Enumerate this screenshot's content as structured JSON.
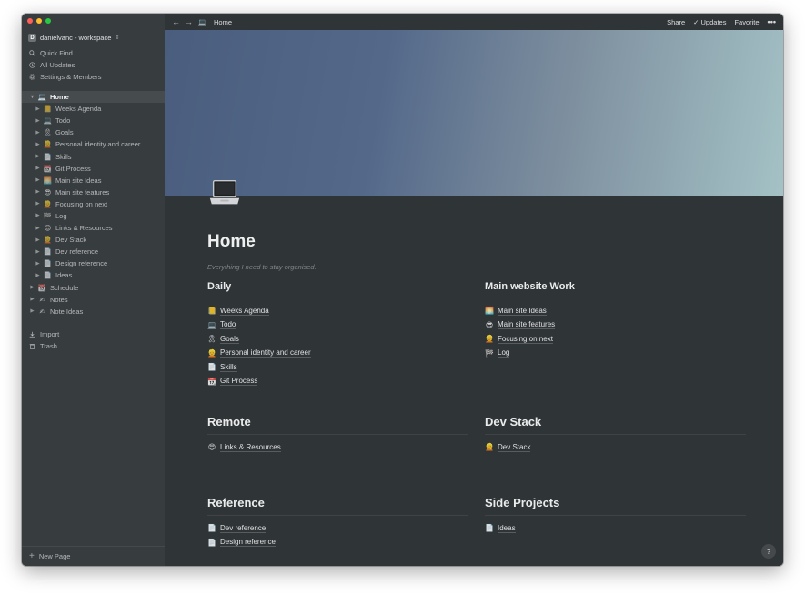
{
  "sidebar": {
    "workspace": {
      "avatar_letter": "D",
      "name": "danielvanc - workspace"
    },
    "menu": [
      {
        "label": "Quick Find",
        "icon": "search-icon"
      },
      {
        "label": "All Updates",
        "icon": "clock-icon"
      },
      {
        "label": "Settings & Members",
        "icon": "gear-icon"
      }
    ],
    "tree": [
      {
        "label": "Home",
        "icon": "laptop-icon",
        "depth": 0,
        "caret": "▼",
        "active": true
      },
      {
        "label": "Weeks Agenda",
        "icon": "notebook-icon",
        "depth": 1,
        "caret": "▶"
      },
      {
        "label": "Todo",
        "icon": "laptop-icon",
        "depth": 1,
        "caret": "▶"
      },
      {
        "label": "Goals",
        "icon": "ribbon-icon",
        "depth": 1,
        "caret": "▶"
      },
      {
        "label": "Personal identity and career",
        "icon": "person-icon",
        "depth": 1,
        "caret": "▶"
      },
      {
        "label": "Skills",
        "icon": "page-icon",
        "depth": 1,
        "caret": "▶"
      },
      {
        "label": "Git Process",
        "icon": "calendar-icon",
        "depth": 1,
        "caret": "▶"
      },
      {
        "label": "Main site Ideas",
        "icon": "sunrise-icon",
        "depth": 1,
        "caret": "▶"
      },
      {
        "label": "Main site features",
        "icon": "sunglasses-icon",
        "depth": 1,
        "caret": "▶"
      },
      {
        "label": "Focusing on next",
        "icon": "person-icon",
        "depth": 1,
        "caret": "▶"
      },
      {
        "label": "Log",
        "icon": "flag-icon",
        "depth": 1,
        "caret": "▶"
      },
      {
        "label": "Links & Resources",
        "icon": "heart-eyes-icon",
        "depth": 1,
        "caret": "▶"
      },
      {
        "label": "Dev Stack",
        "icon": "person-icon",
        "depth": 1,
        "caret": "▶"
      },
      {
        "label": "Dev reference",
        "icon": "page-icon",
        "depth": 1,
        "caret": "▶"
      },
      {
        "label": "Design reference",
        "icon": "page-icon",
        "depth": 1,
        "caret": "▶"
      },
      {
        "label": "Ideas",
        "icon": "page-icon",
        "depth": 1,
        "caret": "▶"
      },
      {
        "label": "Schedule",
        "icon": "calendar-icon",
        "depth": 0,
        "caret": "▶"
      },
      {
        "label": "Notes",
        "icon": "writing-hand-icon",
        "depth": 0,
        "caret": "▶"
      },
      {
        "label": "Note Ideas",
        "icon": "writing-hand-icon",
        "depth": 0,
        "caret": "▶"
      }
    ],
    "bottom": [
      {
        "label": "Import",
        "icon": "download-icon"
      },
      {
        "label": "Trash",
        "icon": "trash-icon"
      }
    ],
    "new_page": "New Page"
  },
  "topbar": {
    "breadcrumb": "Home",
    "share": "Share",
    "updates": "Updates",
    "favorite": "Favorite",
    "more": "•••"
  },
  "page": {
    "title": "Home",
    "subtitle": "Everything I need to stay organised.",
    "sections": {
      "daily": {
        "heading": "Daily",
        "links": [
          {
            "label": "Weeks Agenda",
            "icon": "notebook-icon"
          },
          {
            "label": "Todo",
            "icon": "laptop-icon"
          },
          {
            "label": "Goals",
            "icon": "ribbon-icon"
          },
          {
            "label": "Personal identity and career",
            "icon": "person-icon"
          },
          {
            "label": "Skills",
            "icon": "page-icon"
          },
          {
            "label": "Git Process",
            "icon": "calendar-icon"
          }
        ]
      },
      "main_website": {
        "heading": "Main website Work",
        "links": [
          {
            "label": "Main site Ideas",
            "icon": "sunrise-icon"
          },
          {
            "label": "Main site features",
            "icon": "sunglasses-icon"
          },
          {
            "label": "Focusing on next",
            "icon": "person-icon"
          },
          {
            "label": "Log",
            "icon": "flag-icon"
          }
        ]
      },
      "remote": {
        "heading": "Remote",
        "links": [
          {
            "label": "Links & Resources",
            "icon": "heart-eyes-icon"
          }
        ]
      },
      "dev_stack": {
        "heading": "Dev Stack",
        "links": [
          {
            "label": "Dev Stack",
            "icon": "person-icon"
          }
        ]
      },
      "reference": {
        "heading": "Reference",
        "links": [
          {
            "label": "Dev reference",
            "icon": "page-icon"
          },
          {
            "label": "Design reference",
            "icon": "page-icon"
          }
        ]
      },
      "side_projects": {
        "heading": "Side Projects",
        "links": [
          {
            "label": "Ideas",
            "icon": "page-icon"
          }
        ]
      }
    }
  },
  "help": "?",
  "colors": {
    "sidebar_bg": "#373c3f",
    "main_bg": "#2f3437",
    "cover_start": "#4a5d7e",
    "cover_end": "#a4c2c6"
  }
}
